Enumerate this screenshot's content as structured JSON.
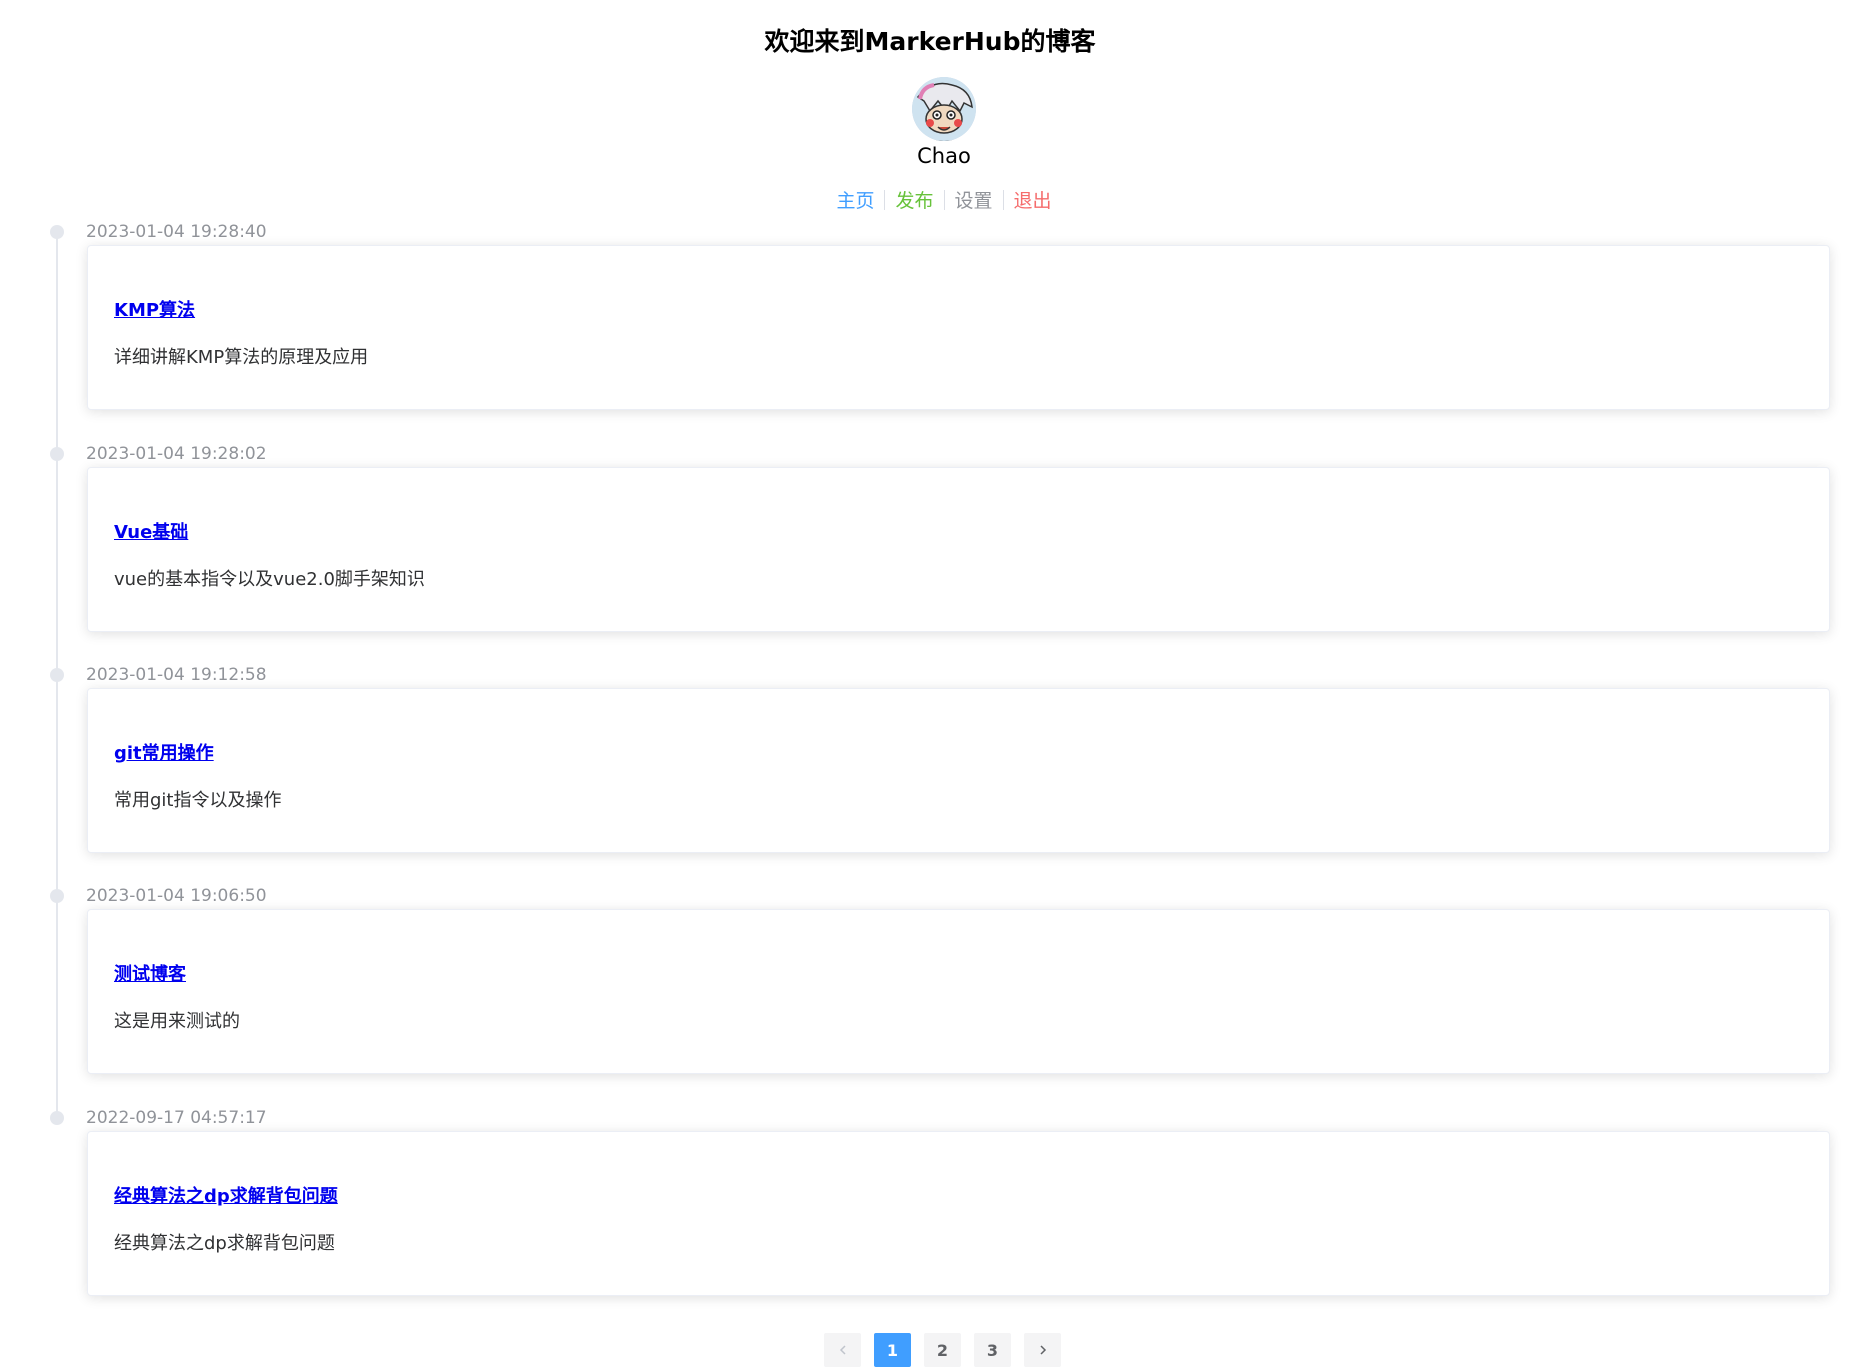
{
  "header": {
    "site_title": "欢迎来到MarkerHub的博客",
    "username": "Chao"
  },
  "nav": [
    {
      "label": "主页",
      "color": "#409eff"
    },
    {
      "label": "发布",
      "color": "#67c23a"
    },
    {
      "label": "设置",
      "color": "#909399"
    },
    {
      "label": "退出",
      "color": "#f56c6c"
    }
  ],
  "posts": [
    {
      "time": "2023-01-04 19:28:40",
      "title": "KMP算法",
      "desc": "详细讲解KMP算法的原理及应用"
    },
    {
      "time": "2023-01-04 19:28:02",
      "title": "Vue基础",
      "desc": "vue的基本指令以及vue2.0脚手架知识"
    },
    {
      "time": "2023-01-04 19:12:58",
      "title": "git常用操作",
      "desc": "常用git指令以及操作"
    },
    {
      "time": "2023-01-04 19:06:50",
      "title": "测试博客",
      "desc": "这是用来测试的"
    },
    {
      "time": "2022-09-17 04:57:17",
      "title": "经典算法之dp求解背包问题",
      "desc": "经典算法之dp求解背包问题"
    }
  ],
  "pagination": {
    "prev_icon": "chevron-left-icon",
    "next_icon": "chevron-right-icon",
    "pages": [
      "1",
      "2",
      "3"
    ],
    "current": "1"
  },
  "colors": {
    "accent": "#409eff",
    "link": "#0000ee"
  }
}
